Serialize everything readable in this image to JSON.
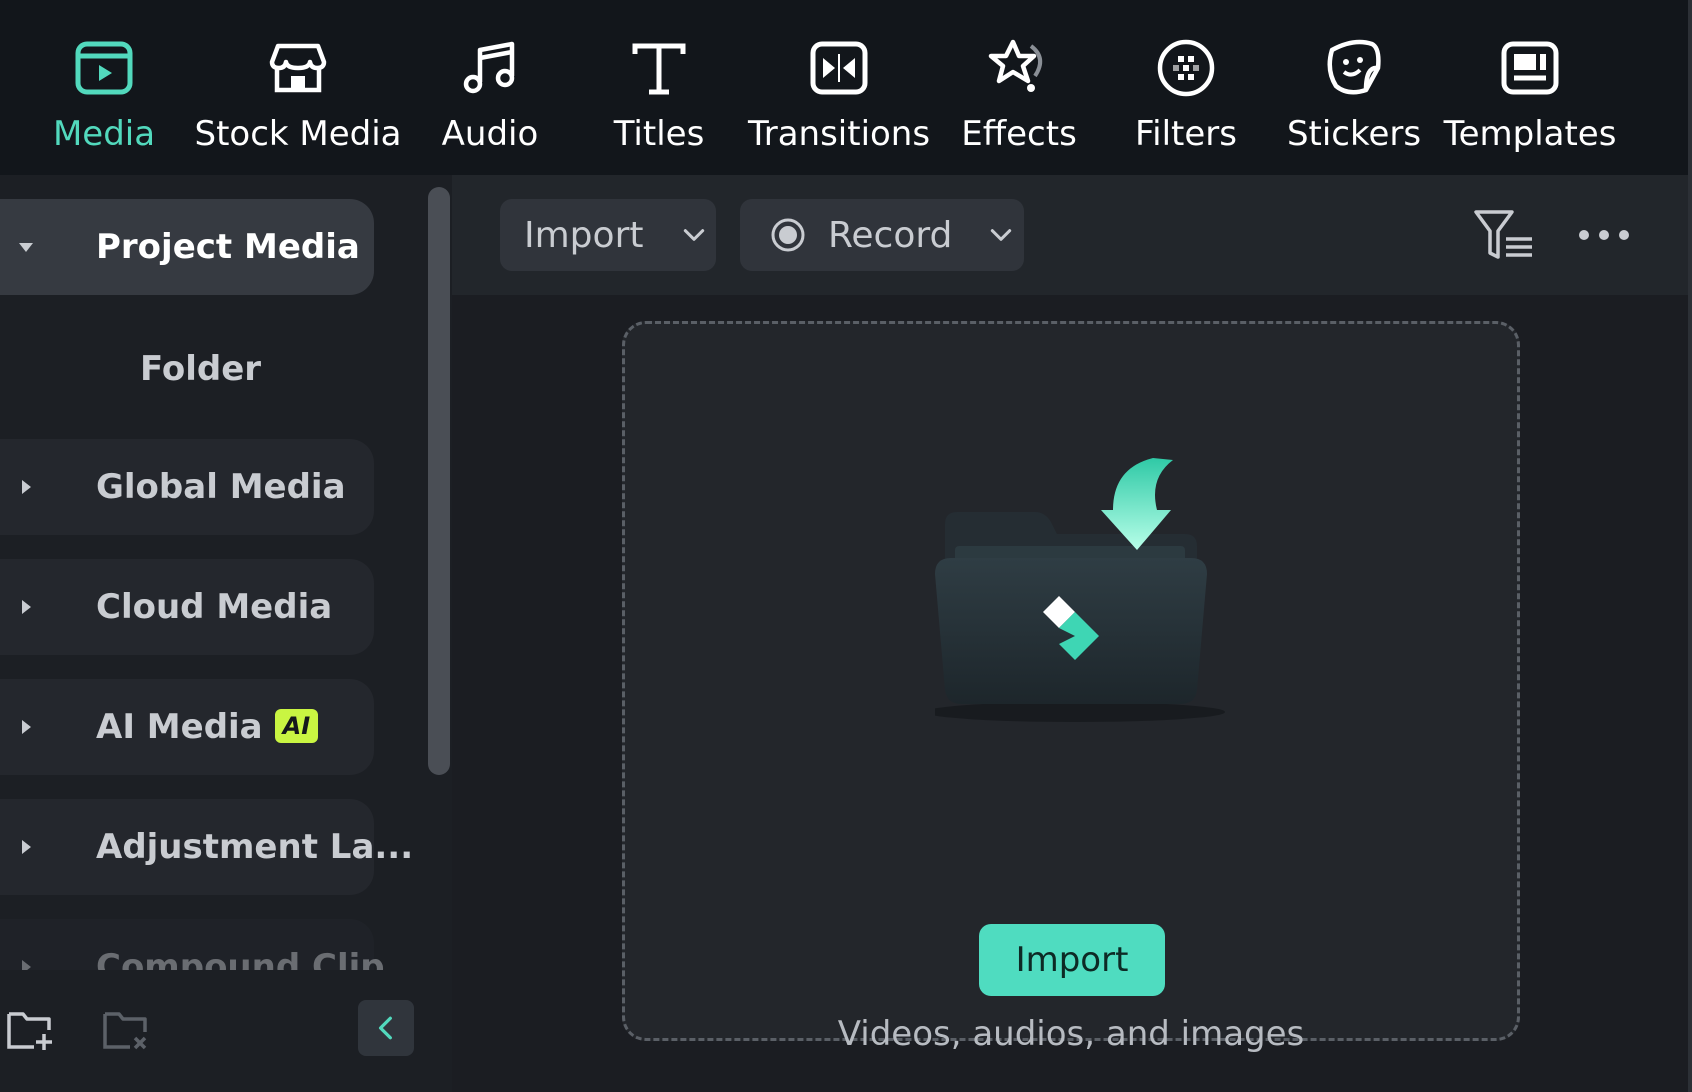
{
  "toolbar": {
    "tabs": [
      {
        "label": "Media",
        "icon": "media-icon"
      },
      {
        "label": "Stock Media",
        "icon": "stock-media-icon"
      },
      {
        "label": "Audio",
        "icon": "music-note-icon"
      },
      {
        "label": "Titles",
        "icon": "text-t-icon"
      },
      {
        "label": "Transitions",
        "icon": "transitions-icon"
      },
      {
        "label": "Effects",
        "icon": "effects-star-icon"
      },
      {
        "label": "Filters",
        "icon": "filters-icon"
      },
      {
        "label": "Stickers",
        "icon": "sticker-icon"
      },
      {
        "label": "Templates",
        "icon": "templates-icon"
      }
    ],
    "active": "Media"
  },
  "sidebar": {
    "items": [
      {
        "label": "Project Media",
        "expanded": true,
        "selected": true
      },
      {
        "label": "Folder"
      },
      {
        "label": "Global Media"
      },
      {
        "label": "Cloud Media"
      },
      {
        "label": "AI Media",
        "badge": "AI"
      },
      {
        "label": "Adjustment La..."
      },
      {
        "label": "Compound Clip"
      }
    ],
    "footer": {
      "new_folder_icon": "folder-add-icon",
      "delete_folder_icon": "folder-delete-icon",
      "collapse_icon": "chevron-left-icon"
    }
  },
  "main": {
    "import_dropdown": "Import",
    "record_dropdown": "Record",
    "filter_icon": "filter-list-icon",
    "more_icon": "more-dots-icon",
    "dropzone": {
      "button_label": "Import",
      "hint": "Videos, audios, and images"
    }
  },
  "colors": {
    "accent": "#52d9bd",
    "toolbar_bg": "#12161b",
    "ai_badge": "#c9f542"
  }
}
